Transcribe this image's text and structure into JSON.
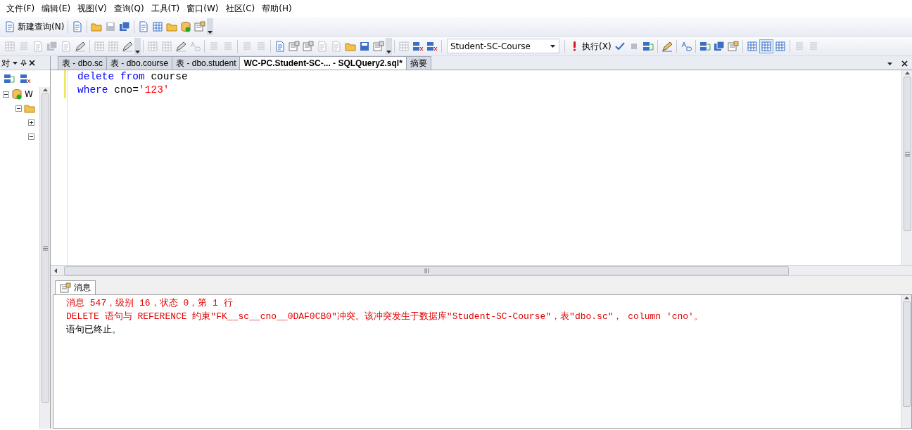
{
  "menu": [
    "文件(F)",
    "编辑(E)",
    "视图(V)",
    "查询(Q)",
    "工具(T)",
    "窗口(W)",
    "社区(C)",
    "帮助(H)"
  ],
  "toolbar": {
    "new_query": "新建查询(N)",
    "database": "Student-SC-Course",
    "execute": "执行(X)"
  },
  "explorer": {
    "title": "对",
    "tree": [
      {
        "label": "W",
        "expanded": true,
        "children": [
          {
            "expanded": true,
            "children": [
              {
                "expanded": false
              },
              {
                "expanded": true
              }
            ]
          }
        ]
      }
    ]
  },
  "tabs": [
    {
      "label": "表 - dbo.sc",
      "selected": false
    },
    {
      "label": "表 - dbo.course",
      "selected": false
    },
    {
      "label": "表 - dbo.student",
      "selected": false
    },
    {
      "label": "WC-PC.Student-SC-... - SQLQuery2.sql*",
      "selected": true
    },
    {
      "label": "摘要",
      "selected": false
    }
  ],
  "editor": {
    "lines": [
      [
        {
          "kind": "keyword",
          "text": "delete from"
        },
        {
          "kind": "plain",
          "text": " course"
        }
      ],
      [
        {
          "kind": "keyword",
          "text": "where"
        },
        {
          "kind": "plain",
          "text": " cno="
        },
        {
          "kind": "string",
          "text": "'123'"
        }
      ]
    ]
  },
  "results": {
    "tab": "消息",
    "messages": [
      {
        "kind": "error",
        "text": "消息 547，级别 16，状态 0，第 1 行"
      },
      {
        "kind": "error",
        "text": "DELETE 语句与 REFERENCE 约束\"FK__sc__cno__0DAF0CB0\"冲突。该冲突发生于数据库\"Student-SC-Course\"，表\"dbo.sc\"， column 'cno'。"
      },
      {
        "kind": "info",
        "text": "语句已终止。"
      }
    ]
  }
}
